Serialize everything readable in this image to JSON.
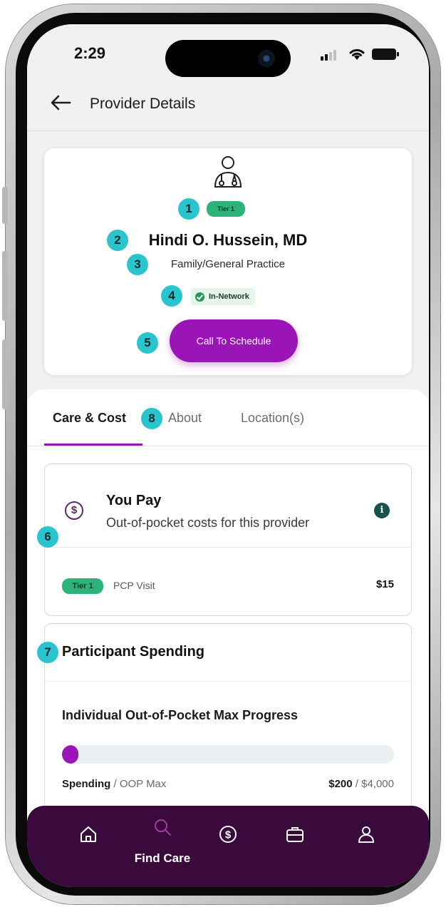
{
  "status_bar": {
    "time": "2:29"
  },
  "header": {
    "title": "Provider Details"
  },
  "provider": {
    "tier": "Tier 1",
    "name": "Hindi O. Hussein, MD",
    "specialty": "Family/General Practice",
    "network_status": "In-Network",
    "cta_label": "Call To Schedule"
  },
  "tabs": [
    {
      "label": "Care & Cost",
      "active": true
    },
    {
      "label": "About",
      "active": false
    },
    {
      "label": "Location(s)",
      "active": false
    }
  ],
  "you_pay": {
    "title": "You Pay",
    "subtitle": "Out-of-pocket costs for this provider",
    "rows": [
      {
        "tier": "Tier 1",
        "label": "PCP Visit",
        "amount": "$15"
      }
    ]
  },
  "participant_spending": {
    "title": "Participant Spending",
    "progress_title": "Individual Out-of-Pocket Max Progress",
    "legend_strong": "Spending",
    "legend_light": " / OOP Max",
    "spent": "$200",
    "max": " / $4,000",
    "progress_fraction": 0.05
  },
  "callouts": [
    "1",
    "2",
    "3",
    "4",
    "5",
    "6",
    "7",
    "8"
  ],
  "nav": {
    "items": [
      {
        "icon": "home-icon",
        "label": ""
      },
      {
        "icon": "search-icon",
        "label": "Find Care"
      },
      {
        "icon": "dollar-icon",
        "label": ""
      },
      {
        "icon": "briefcase-icon",
        "label": ""
      },
      {
        "icon": "person-icon",
        "label": ""
      }
    ]
  },
  "colors": {
    "accent": "#9b14b8",
    "tier_green": "#2db37a",
    "callout_cyan": "#2ac4cf",
    "nav_bg": "#3a0a3c"
  }
}
